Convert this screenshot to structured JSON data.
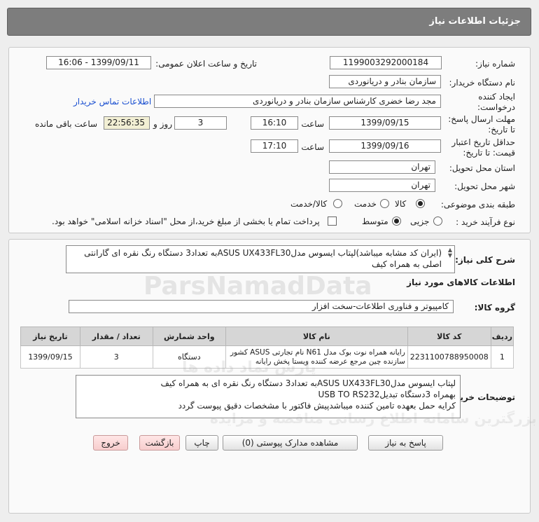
{
  "header": {
    "title": "جزئیات اطلاعات نیاز"
  },
  "form": {
    "need_number_label": "شماره نیاز:",
    "need_number": "1199003292000184",
    "announce_label": "تاریخ و ساعت اعلان عمومی:",
    "announce_value": "1399/09/11 - 16:06",
    "buyer_org_label": "نام دستگاه خریدار:",
    "buyer_org": "سازمان بنادر و دریانوردی",
    "creator_label_1": "ایجاد کننده",
    "creator_label_2": "درخواست:",
    "creator": "مجد رضا خضری کارشناس سازمان بنادر و دریانوردی",
    "contact_link": "اطلاعات تماس خریدار",
    "deadline_label_1": "مهلت ارسال پاسخ:",
    "deadline_label_2": "تا تاریخ:",
    "deadline_date": "1399/09/15",
    "time_label": "ساعت",
    "deadline_time": "16:10",
    "days_value": "3",
    "days_label": "روز و",
    "remaining_time": "22:56:35",
    "remaining_label": "ساعت باقی مانده",
    "validity_label_1": "حداقل تاریخ اعتبار",
    "validity_label_2": "قیمت: تا تاریخ:",
    "validity_date": "1399/09/16",
    "validity_time_label": "ساعت",
    "validity_time": "17:10",
    "province_label": "استان محل تحویل:",
    "province": "تهران",
    "city_label": "شهر محل تحویل:",
    "city": "تهران",
    "category_label": "طبقه بندی موضوعی:",
    "category_options": [
      "کالا",
      "خدمت",
      "کالا/خدمت"
    ],
    "category_selected": "کالا",
    "process_label": "نوع فرآیند خرید :",
    "process_options": [
      "جزیی",
      "متوسط"
    ],
    "process_selected": "متوسط",
    "payment_note": "پرداخت تمام یا بخشی از مبلغ خرید،از محل \"اسناد خزانه اسلامی\" خواهد بود."
  },
  "description": {
    "label": "شرح کلی نیاز:",
    "text": "(ایران کد مشابه میباشد)لپتاب ایسوس مدلASUS UX433FL30به تعداد3 دستگاه رنگ نقره ای  گارانتی اصلی به همراه کیف"
  },
  "goods": {
    "section_title": "اطلاعات کالاهای مورد نیاز",
    "group_label": "گروه کالا:",
    "group_value": "کامپیوتر و فناوری اطلاعات-سخت افزار",
    "columns": [
      "ردیف",
      "کد کالا",
      "نام کالا",
      "واحد شمارش",
      "تعداد / مقدار",
      "تاریخ نیاز"
    ],
    "rows": [
      {
        "row": "1",
        "code": "2231100788950008",
        "name": "رایانه همراه نوت بوک مدل N61 نام تجارتی ASUS کشور سازنده چین مرجع عرضه کننده ویستا پخش رایانه",
        "unit": "دستگاه",
        "qty": "3",
        "date": "1399/09/15"
      }
    ]
  },
  "buyer_notes": {
    "label": "توضیحات خریدار:",
    "line1": "لپتاب ایسوس مدلASUS UX433FL30به تعداد3 دستگاه رنگ نقره ای به همراه کیف",
    "line2": "بهمراه 3دستگاه تبدیلUSB TO RS232",
    "line3": "کرایه حمل بعهده تامین کننده میباشدپیش فاکتور با مشخصات دقیق پیوست گردد"
  },
  "buttons": {
    "reply": "پاسخ به نیاز",
    "attachments": "مشاهده مدارک پیوستی (0)",
    "print": "چاپ",
    "back": "بازگشت",
    "exit": "خروج"
  },
  "watermark": {
    "brand": "ParsNamadData",
    "brand_fa": "پارس نماد داده ها",
    "sub": "بزرگترین سامانه اطلاع رسانی مناقصه و مزایده"
  }
}
